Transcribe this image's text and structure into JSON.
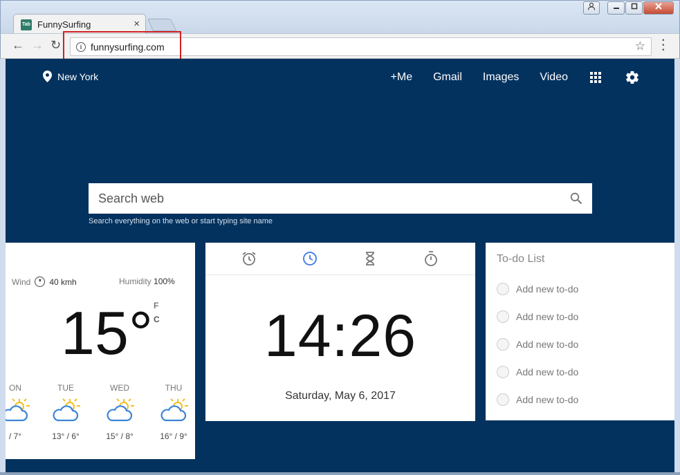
{
  "browser": {
    "tab_title": "FunnySurfing",
    "tab_favicon_text": "Tab",
    "tab_close": "×",
    "url": "funnysurfing.com",
    "buttons": {
      "back": "←",
      "forward": "→",
      "reload": "↻",
      "star": "☆"
    }
  },
  "header": {
    "location": "New York",
    "nav": [
      "+Me",
      "Gmail",
      "Images",
      "Video"
    ]
  },
  "search": {
    "placeholder": "Search web",
    "hint": "Search everything on the web or start typing site name"
  },
  "weather": {
    "wind_label": "Wind",
    "wind_value": "40 kmh",
    "humidity_label": "Humidity",
    "humidity_value": "100%",
    "temperature": "15°",
    "unit_f": "F",
    "unit_c": "C",
    "forecast": [
      {
        "day": "ON",
        "temp": "/ 7°"
      },
      {
        "day": "TUE",
        "temp": "13° / 6°"
      },
      {
        "day": "WED",
        "temp": "15° / 8°"
      },
      {
        "day": "THU",
        "temp": "16° / 9°"
      }
    ]
  },
  "clock": {
    "time": "14:26",
    "date": "Saturday, May 6, 2017",
    "tabs": [
      "alarm-icon",
      "clock-icon",
      "hourglass-icon",
      "stopwatch-icon"
    ]
  },
  "todo": {
    "title": "To-do List",
    "items": [
      "Add new to-do",
      "Add new to-do",
      "Add new to-do",
      "Add new to-do",
      "Add new to-do"
    ]
  },
  "colors": {
    "page_background": "#03325f",
    "accent_active_tab": "#3b78e7",
    "sun": "#f4c01a",
    "cloud": "#3b84d8"
  }
}
